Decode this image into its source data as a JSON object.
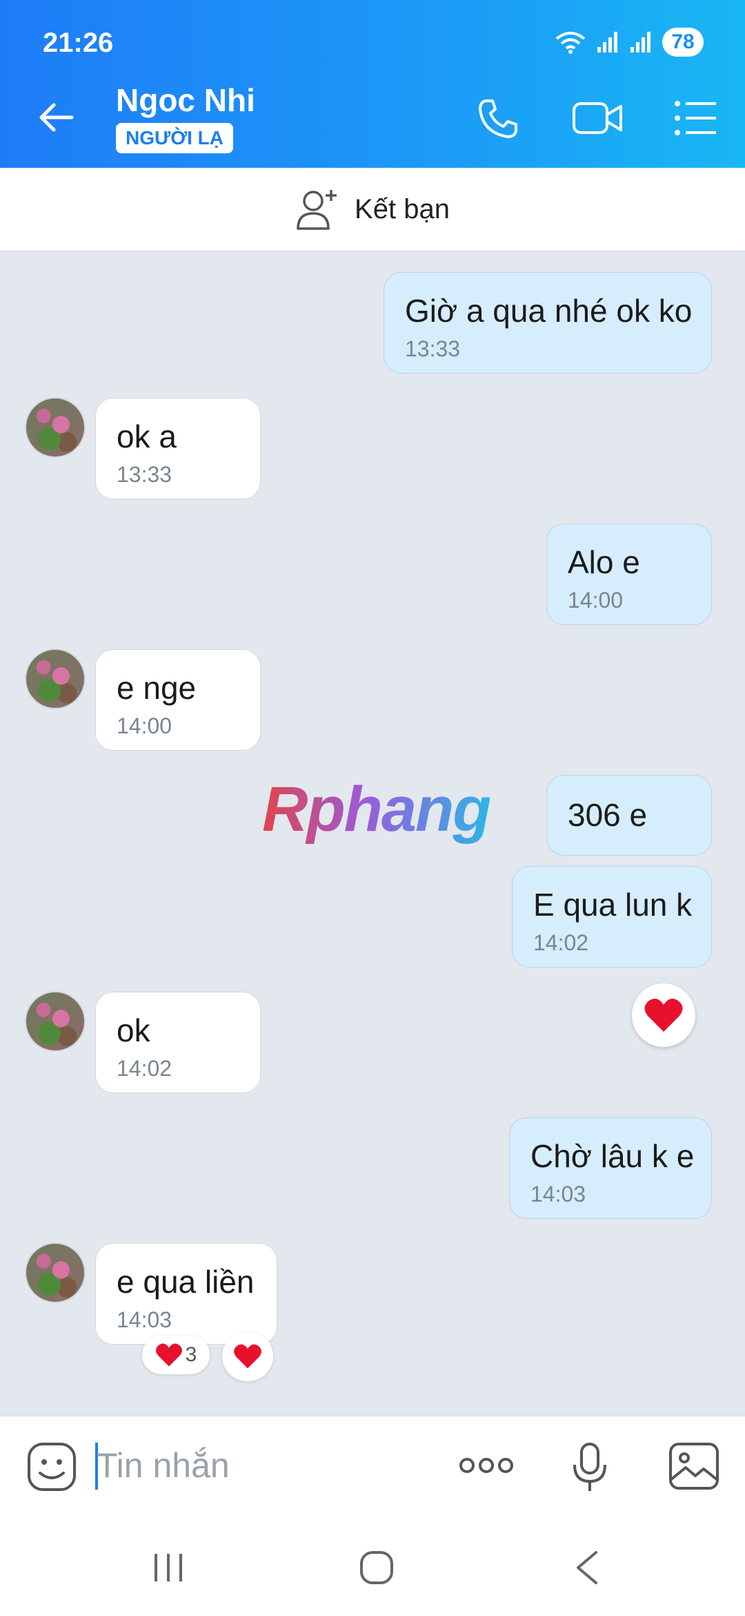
{
  "status_bar": {
    "time": "21:26",
    "battery": "78"
  },
  "header": {
    "contact_name": "Ngoc Nhi",
    "badge": "NGƯỜI LẠ"
  },
  "friend_bar": {
    "label": "Kết bạn"
  },
  "watermark": "Rphang",
  "messages": [
    {
      "text": "Giờ a qua nhé ok ko",
      "time": "13:33",
      "dir": "out"
    },
    {
      "text": "ok a",
      "time": "13:33",
      "dir": "in"
    },
    {
      "text": "Alo e",
      "time": "14:00",
      "dir": "out"
    },
    {
      "text": "e nge",
      "time": "14:00",
      "dir": "in"
    },
    {
      "text": "306 e",
      "time": "",
      "dir": "out"
    },
    {
      "text": "E qua lun k",
      "time": "14:02",
      "dir": "out"
    },
    {
      "text": "ok",
      "time": "14:02",
      "dir": "in"
    },
    {
      "text": "Chờ lâu k e",
      "time": "14:03",
      "dir": "out"
    },
    {
      "text": "e qua liền",
      "time": "14:03",
      "dir": "in"
    }
  ],
  "reactions": {
    "heart_count": "3"
  },
  "composer": {
    "placeholder": "Tin nhắn"
  },
  "colors": {
    "accent": "#1b8ff6",
    "outgoing_bubble": "#d5edfc",
    "background": "#e3e7ee"
  }
}
